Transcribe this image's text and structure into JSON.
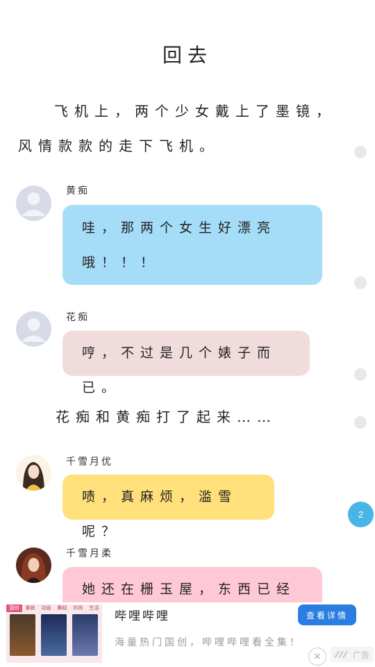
{
  "title": "回去",
  "narration_1": "飞机上，两个少女戴上了墨镜，风情款款的走下飞机。",
  "messages": [
    {
      "name": "黄痴",
      "text": "哇，那两个女生好漂亮哦！！！"
    },
    {
      "name": "花痴",
      "text": "哼，不过是几个婊子而已。"
    },
    {
      "name": "千雪月优",
      "text": "啧，真麻烦，滥雪呢？"
    },
    {
      "name": "千雪月柔",
      "text": "她还在栅玉屋，东西已经运过"
    }
  ],
  "narration_2": "花痴和黄痴打了起来……",
  "page_badge": "2",
  "ad": {
    "tabs": [
      "国创",
      "番剧",
      "动画",
      "舞蹈",
      "时尚",
      "生活"
    ],
    "title": "哔哩哔哩",
    "description": "海量热门国创，哔哩哔哩看全集！",
    "button_label": "查看详情",
    "close_icon": "×",
    "mark_label": "广告"
  },
  "colors": {
    "bubble_blue": "#a5dcf7",
    "bubble_pink_light": "#f0dcdc",
    "bubble_yellow": "#ffe07a",
    "bubble_pink": "#ffc8d6",
    "accent": "#47b5e6",
    "ad_button": "#2a7de1"
  }
}
